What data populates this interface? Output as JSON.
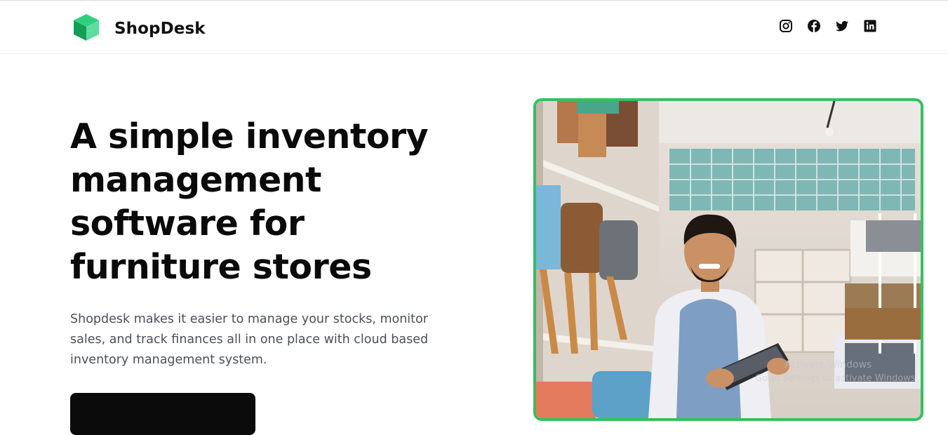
{
  "brand": {
    "name": "ShopDesk",
    "logo_icon": "cube-logo-icon",
    "accent": "#1fb86a"
  },
  "socials": [
    {
      "icon": "instagram-icon"
    },
    {
      "icon": "facebook-icon"
    },
    {
      "icon": "twitter-icon"
    },
    {
      "icon": "linkedin-icon"
    }
  ],
  "hero": {
    "headline_lines": [
      "A simple inventory",
      "management",
      "software for",
      "furniture stores"
    ],
    "description_lines": [
      "Shopdesk makes it easier to manage your stocks, monitor",
      "sales, and track finances all in one place with cloud based",
      "inventory management system."
    ],
    "cta_label": "",
    "image_border_color": "#34c15f"
  },
  "os_watermark": {
    "line1": "Activate Windows",
    "line2": "Go to Settings to activate Windows."
  }
}
